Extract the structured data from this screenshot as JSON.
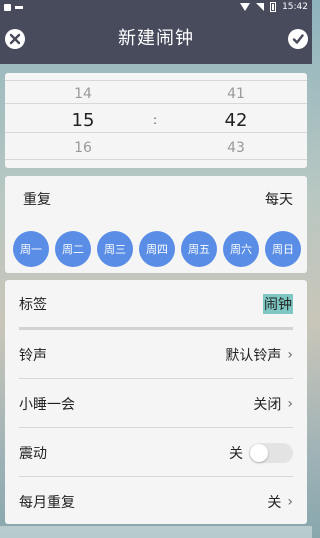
{
  "status_bar": {
    "time": "15:42"
  },
  "app_bar": {
    "title": "新建闹钟"
  },
  "time_picker": {
    "hour_prev": "14",
    "hour_selected": "15",
    "hour_next": "16",
    "minute_prev": "41",
    "minute_selected": "42",
    "minute_next": "43",
    "separator": ":"
  },
  "repeat": {
    "label": "重复",
    "value": "每天",
    "days": [
      "周一",
      "周二",
      "周三",
      "周四",
      "周五",
      "周六",
      "周日"
    ]
  },
  "settings": {
    "tag_label": "标签",
    "tag_value": "闹钟",
    "ringtone_label": "铃声",
    "ringtone_value": "默认铃声",
    "snooze_label": "小睡一会",
    "snooze_value": "关闭",
    "vibrate_label": "震动",
    "vibrate_value": "关",
    "monthly_label": "每月重复",
    "monthly_value": "关"
  },
  "colors": {
    "bar": "#474b5c",
    "accent": "#5a8ee6",
    "highlight": "#7fc7c3"
  },
  "icons": {
    "close": "close-icon",
    "confirm": "check-icon",
    "chevron": "chevron-right-icon"
  }
}
